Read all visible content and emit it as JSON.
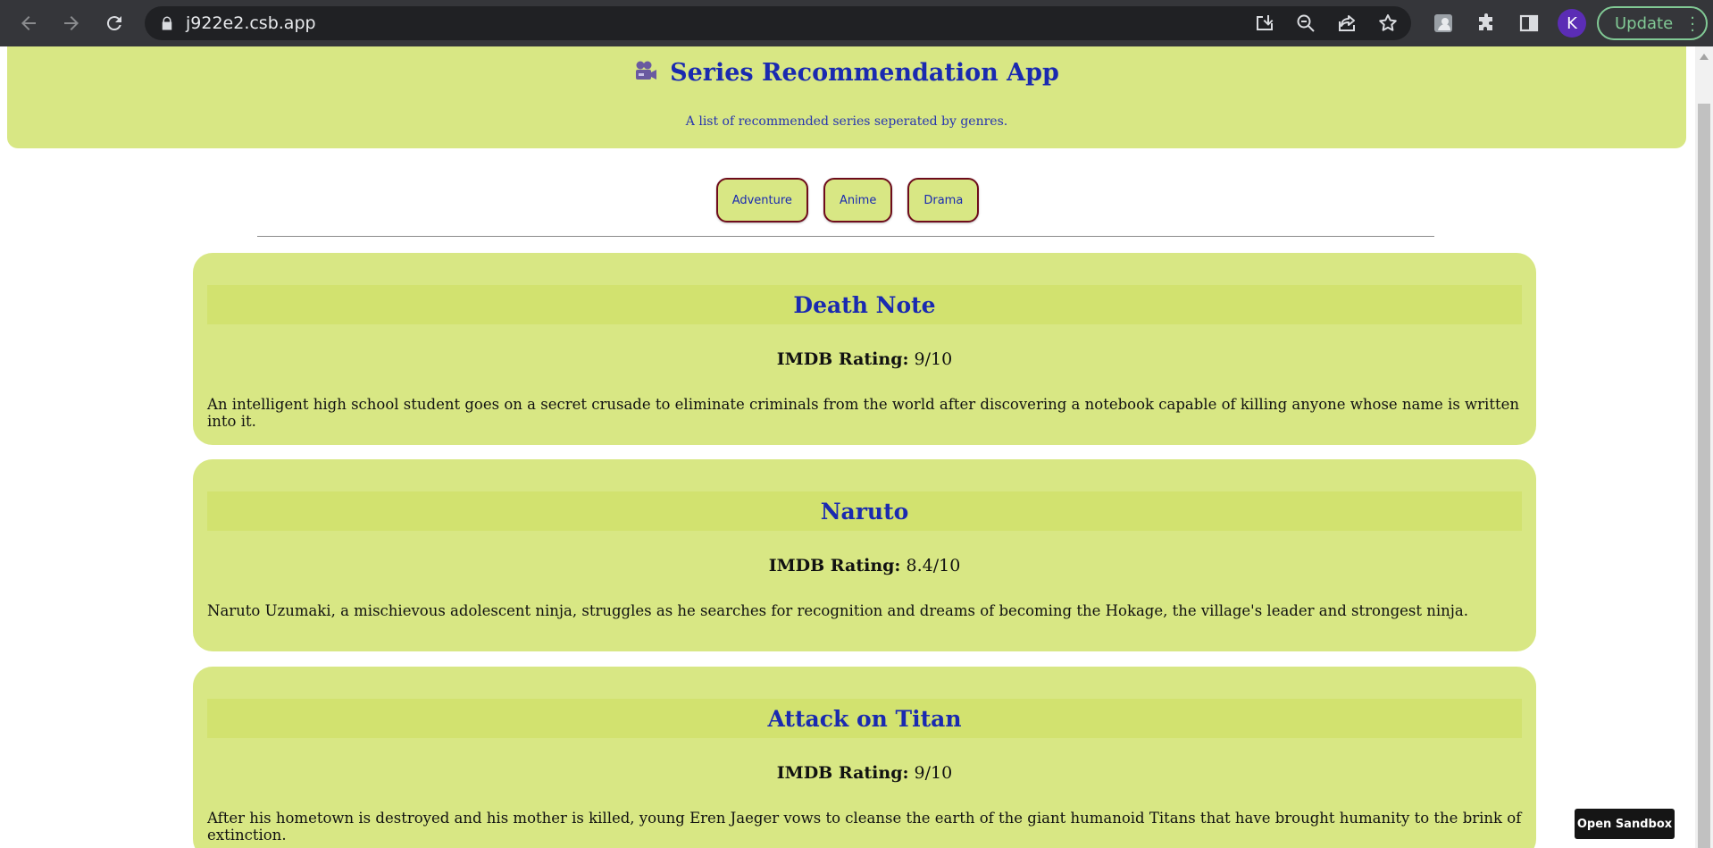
{
  "browser": {
    "url": "j922e2.csb.app",
    "avatar_letter": "K",
    "update_label": "Update"
  },
  "header": {
    "title": "Series Recommendation App",
    "subtitle": "A list of recommended series seperated by genres."
  },
  "genres": [
    "Adventure",
    "Anime",
    "Drama"
  ],
  "series": [
    {
      "title": "Death Note",
      "rating_label": "IMDB Rating:",
      "rating_value": "9/10",
      "description": "An intelligent high school student goes on a secret crusade to eliminate criminals from the world after discovering a notebook capable of killing anyone whose name is written into it."
    },
    {
      "title": "Naruto",
      "rating_label": "IMDB Rating:",
      "rating_value": "8.4/10",
      "description": "Naruto Uzumaki, a mischievous adolescent ninja, struggles as he searches for recognition and dreams of becoming the Hokage, the village's leader and strongest ninja."
    },
    {
      "title": "Attack on Titan",
      "rating_label": "IMDB Rating:",
      "rating_value": "9/10",
      "description": "After his hometown is destroyed and his mother is killed, young Eren Jaeger vows to cleanse the earth of the giant humanoid Titans that have brought humanity to the brink of extinction."
    }
  ],
  "sandbox": {
    "label": "Open Sandbox"
  },
  "colors": {
    "accent": "#d8e784",
    "title_blue": "#1a2ab0",
    "button_border": "#6e0c1c"
  },
  "icons": [
    "back-arrow-icon",
    "forward-arrow-icon",
    "reload-icon",
    "lock-icon",
    "install-icon",
    "zoom-out-icon",
    "share-icon",
    "bookmark-star-icon",
    "extension-image-icon",
    "puzzle-icon",
    "side-panel-icon",
    "movie-camera-icon"
  ]
}
